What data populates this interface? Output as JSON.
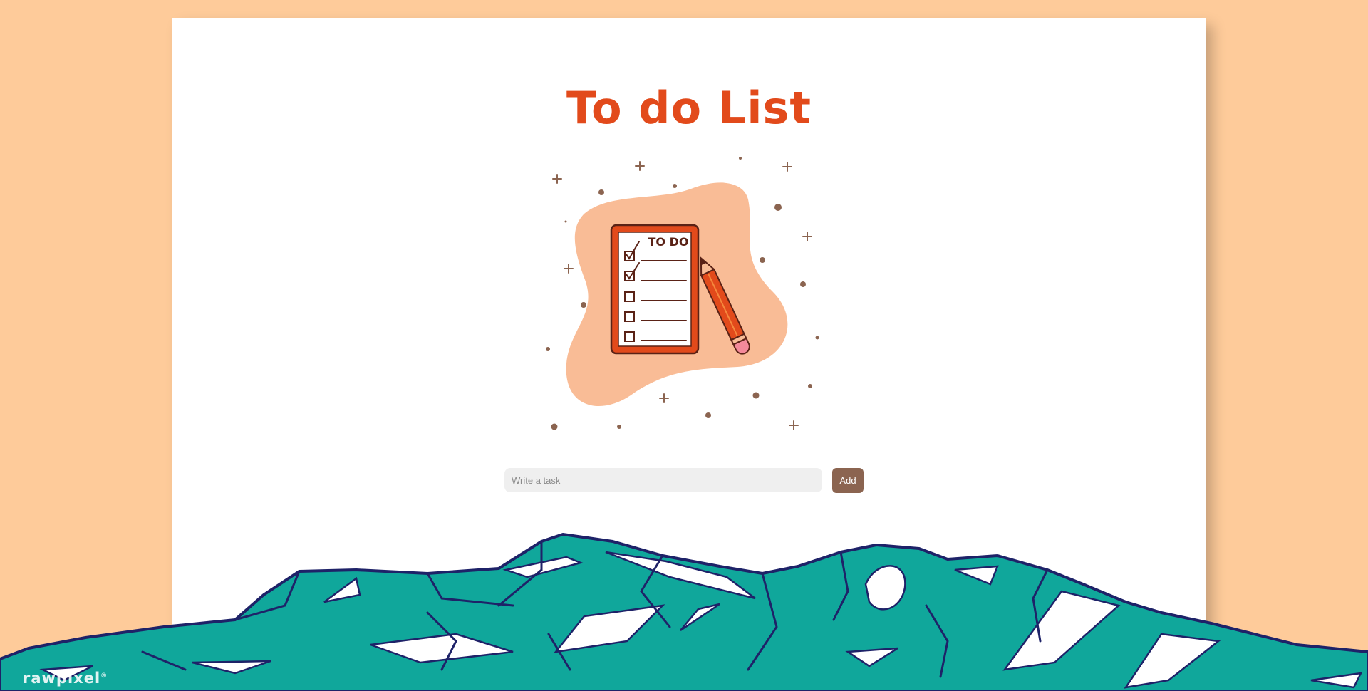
{
  "app": {
    "title": "To do List"
  },
  "illustration": {
    "icon": "todo-clipboard-illustration",
    "clipboard_heading": "TO DO",
    "colors": {
      "blob": "#F9BC96",
      "accent": "#E24A1B",
      "dots": "#8B6450"
    }
  },
  "task_form": {
    "input_placeholder": "Write a task",
    "input_value": "",
    "add_label": "Add"
  },
  "footer": {
    "watermark": "rawpixel"
  },
  "colors": {
    "background": "#FECB9A",
    "card": "#FFFFFF",
    "title": "#E24A1B",
    "button": "#8B6450",
    "mountain": "#10A79B",
    "mountain_outline": "#1E2268"
  }
}
